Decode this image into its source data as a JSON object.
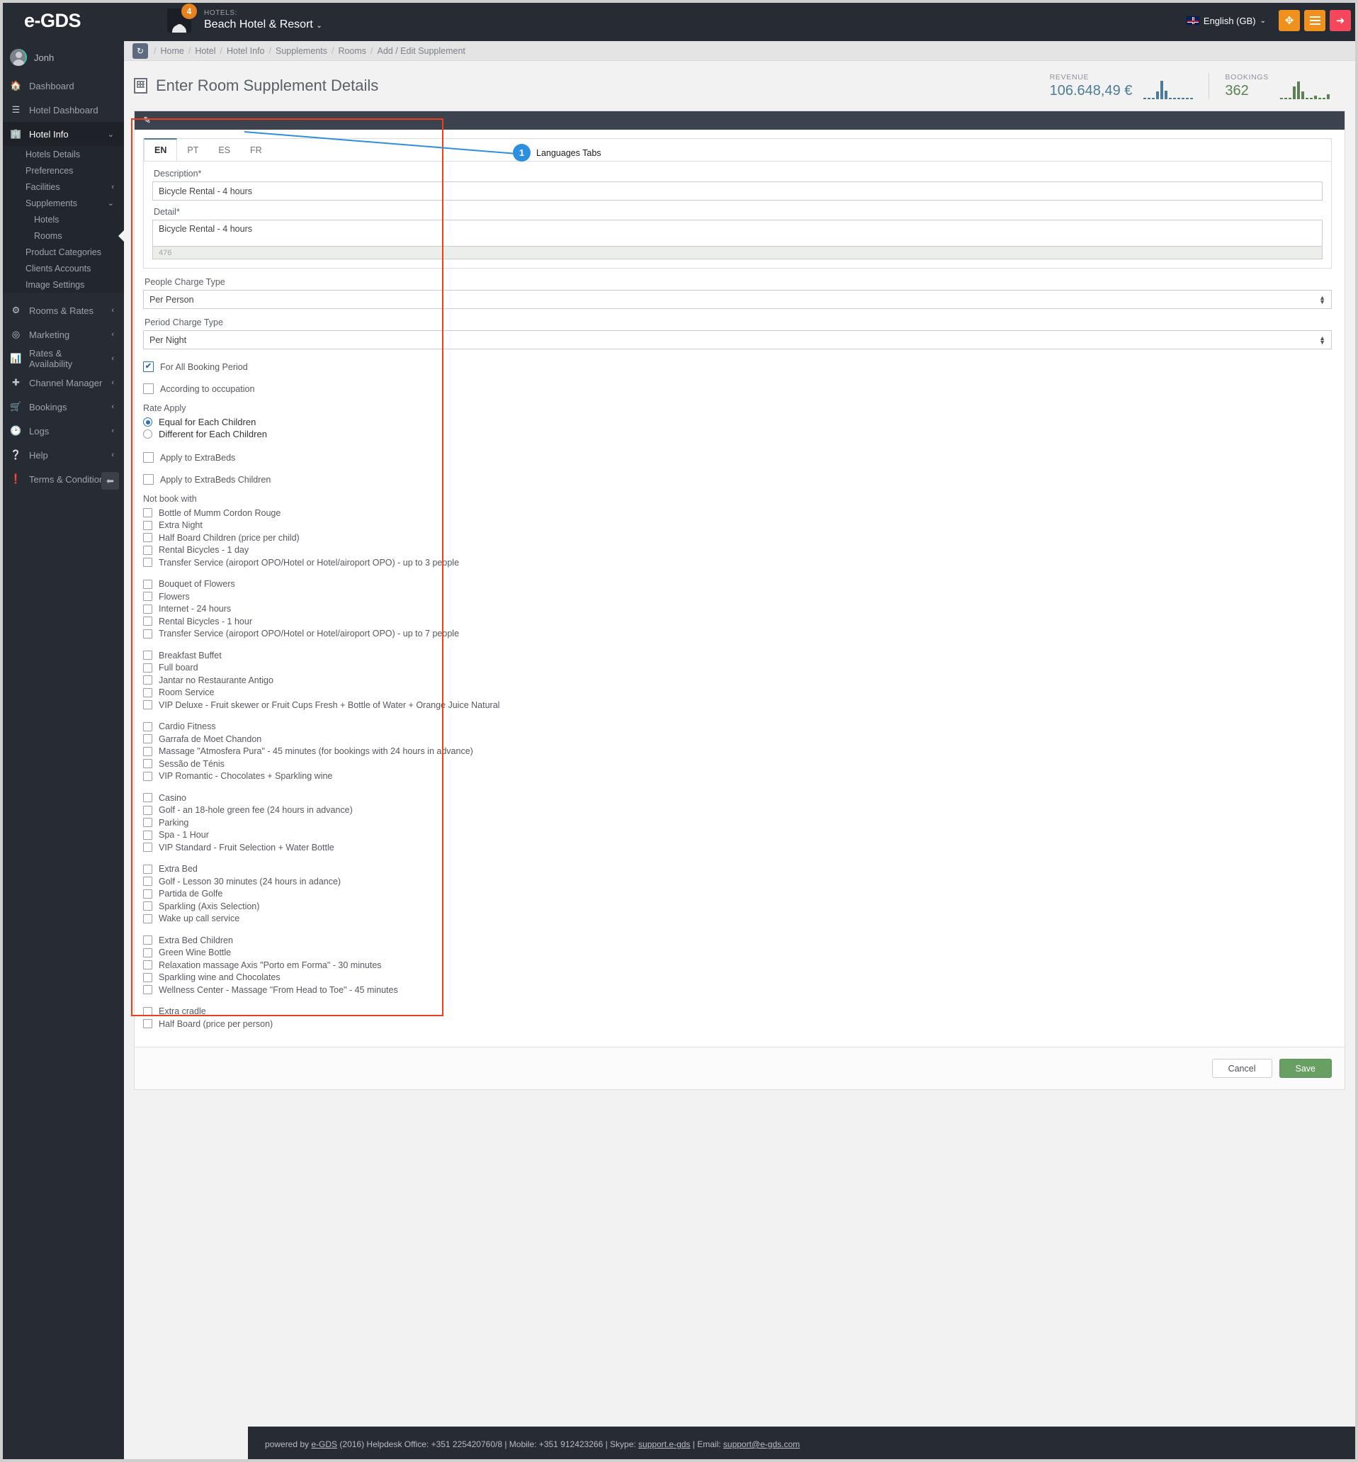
{
  "brand": "e-GDS",
  "topbar": {
    "notification_count": "4",
    "hotels_label": "HOTELS:",
    "hotel_name": "Beach Hotel & Resort",
    "language": "English (GB)",
    "expand_icon": "expand-arrows-icon",
    "menu_icon": "hamburger-icon",
    "logout_icon": "logout-icon"
  },
  "sidebar": {
    "user": "Jonh",
    "items": [
      {
        "label": "Dashboard",
        "icon": "home-icon",
        "chevron": ""
      },
      {
        "label": "Hotel Dashboard",
        "icon": "list-icon",
        "chevron": ""
      },
      {
        "label": "Hotel Info",
        "icon": "building-icon",
        "chevron": "⌄",
        "active": true
      }
    ],
    "sub_items": [
      {
        "label": "Hotels Details",
        "chevron": ""
      },
      {
        "label": "Preferences",
        "chevron": ""
      },
      {
        "label": "Facilities",
        "chevron": "‹"
      },
      {
        "label": "Supplements",
        "chevron": "⌄"
      },
      {
        "label": "Hotels",
        "deeper": true,
        "chevron": ""
      },
      {
        "label": "Rooms",
        "deeper": true,
        "chevron": "",
        "selected": true
      },
      {
        "label": "Product Categories",
        "chevron": ""
      },
      {
        "label": "Clients Accounts",
        "chevron": ""
      },
      {
        "label": "Image Settings",
        "chevron": ""
      }
    ],
    "items_bottom": [
      {
        "label": "Rooms & Rates",
        "icon": "gears-icon",
        "chevron": "‹"
      },
      {
        "label": "Marketing",
        "icon": "target-icon",
        "chevron": "‹"
      },
      {
        "label": "Rates & Availability",
        "icon": "bar-chart-icon",
        "chevron": "‹"
      },
      {
        "label": "Channel Manager",
        "icon": "move-icon",
        "chevron": "‹"
      },
      {
        "label": "Bookings",
        "icon": "cart-icon",
        "chevron": "‹"
      },
      {
        "label": "Logs",
        "icon": "clock-icon",
        "chevron": "‹"
      },
      {
        "label": "Help",
        "icon": "question-circle-icon",
        "chevron": "‹"
      },
      {
        "label": "Terms & Conditions",
        "icon": "exclamation-circle-icon",
        "chevron": ""
      }
    ],
    "collapse_icon": "collapse-left-icon"
  },
  "breadcrumb": {
    "refresh_icon": "refresh-icon",
    "items": [
      "Home",
      "Hotel",
      "Hotel Info",
      "Supplements",
      "Rooms",
      "Add / Edit Supplement"
    ]
  },
  "page": {
    "title": "Enter Room Supplement Details",
    "title_icon": "building-icon",
    "panel_icon": "edit-icon"
  },
  "stats": {
    "revenue_label": "REVENUE",
    "revenue_value": "106.648,49 €",
    "bookings_label": "BOOKINGS",
    "bookings_value": "362"
  },
  "chart_data": [
    {
      "type": "bar",
      "title": "REVENUE",
      "categories": [
        "1",
        "2",
        "3",
        "4",
        "5",
        "6",
        "7",
        "8",
        "9",
        "10",
        "11",
        "12"
      ],
      "values": [
        1,
        1,
        1,
        11,
        26,
        12,
        1,
        1,
        1,
        1,
        1,
        1
      ],
      "ylim": [
        0,
        26
      ],
      "color": "#4e7c96",
      "grid": false,
      "xlabel": "",
      "ylabel": ""
    },
    {
      "type": "bar",
      "title": "BOOKINGS",
      "categories": [
        "1",
        "2",
        "3",
        "4",
        "5",
        "6",
        "7",
        "8",
        "9",
        "10",
        "11",
        "12"
      ],
      "values": [
        1,
        1,
        1,
        18,
        25,
        11,
        1,
        1,
        5,
        1,
        1,
        7
      ],
      "ylim": [
        0,
        25
      ],
      "color": "#5d7f54",
      "grid": false,
      "xlabel": "",
      "ylabel": ""
    }
  ],
  "annotation": {
    "number": "1",
    "text": "Languages Tabs"
  },
  "form": {
    "tabs": [
      {
        "label": "EN",
        "active": true
      },
      {
        "label": "PT",
        "active": false
      },
      {
        "label": "ES",
        "active": false
      },
      {
        "label": "FR",
        "active": false
      }
    ],
    "description_label": "Description*",
    "description_value": "Bicycle Rental - 4 hours",
    "detail_label": "Detail*",
    "detail_value": "Bicycle Rental - 4 hours",
    "detail_charcount": "476",
    "people_charge_label": "People Charge Type",
    "people_charge_value": "Per Person",
    "period_charge_label": "Period Charge Type",
    "period_charge_value": "Per Night",
    "for_all_booking_period": "For All Booking Period",
    "for_all_booking_period_checked": true,
    "according_to_occupation": "According to occupation",
    "according_to_occupation_checked": false,
    "rate_apply_label": "Rate Apply",
    "rate_apply_options": [
      {
        "label": "Equal for Each Children",
        "checked": true
      },
      {
        "label": "Different for Each Children",
        "checked": false
      }
    ],
    "apply_extrabeds": "Apply to ExtraBeds",
    "apply_extrabeds_checked": false,
    "apply_extrabeds_children": "Apply to ExtraBeds Children",
    "apply_extrabeds_children_checked": false,
    "not_book_with_label": "Not book with",
    "not_book_with_groups": [
      [
        "Bottle of Mumm Cordon Rouge",
        "Extra Night",
        "Half Board Children (price per child)",
        "Rental Bicycles - 1 day",
        "Transfer Service (airoport OPO/Hotel or Hotel/airoport OPO) - up to 3 people"
      ],
      [
        "Bouquet of Flowers",
        "Flowers",
        "Internet - 24 hours",
        "Rental Bicycles - 1 hour",
        "Transfer Service (airoport OPO/Hotel or Hotel/airoport OPO) - up to 7 people"
      ],
      [
        "Breakfast Buffet",
        "Full board",
        "Jantar no Restaurante Antigo",
        "Room Service",
        "VIP Deluxe - Fruit skewer or Fruit Cups Fresh + Bottle of Water + Orange Juice Natural"
      ],
      [
        "Cardio Fitness",
        "Garrafa de Moet Chandon",
        "Massage \"Atmosfera Pura\" - 45 minutes (for bookings with 24 hours in advance)",
        "Sessão de Ténis",
        "VIP Romantic - Chocolates + Sparkling wine"
      ],
      [
        "Casino",
        "Golf - an 18-hole green fee (24 hours in advance)",
        "Parking",
        "Spa - 1 Hour",
        "VIP Standard - Fruit Selection + Water Bottle"
      ],
      [
        "Extra Bed",
        "Golf - Lesson 30 minutes (24 hours in adance)",
        "Partida de Golfe",
        "Sparkling (Axis Selection)",
        "Wake up call service"
      ],
      [
        "Extra Bed Children",
        "Green Wine Bottle",
        "Relaxation massage Axis \"Porto em Forma\" - 30 minutes",
        "Sparkling wine and Chocolates",
        "Wellness Center - Massage \"From Head to Toe\" - 45 minutes"
      ],
      [
        "Extra cradle",
        "Half Board (price per person)"
      ]
    ],
    "cancel_label": "Cancel",
    "save_label": "Save"
  },
  "footer": {
    "text_1": "powered by ",
    "link_1": "e-GDS",
    "text_2": " (2016) Helpdesk Office: +351 225420760/8  |  Mobile: +351 912423266  |  Skype: ",
    "link_2": "support.e-gds",
    "text_3": "  |  Email: ",
    "link_3": "support@e-gds.com"
  }
}
